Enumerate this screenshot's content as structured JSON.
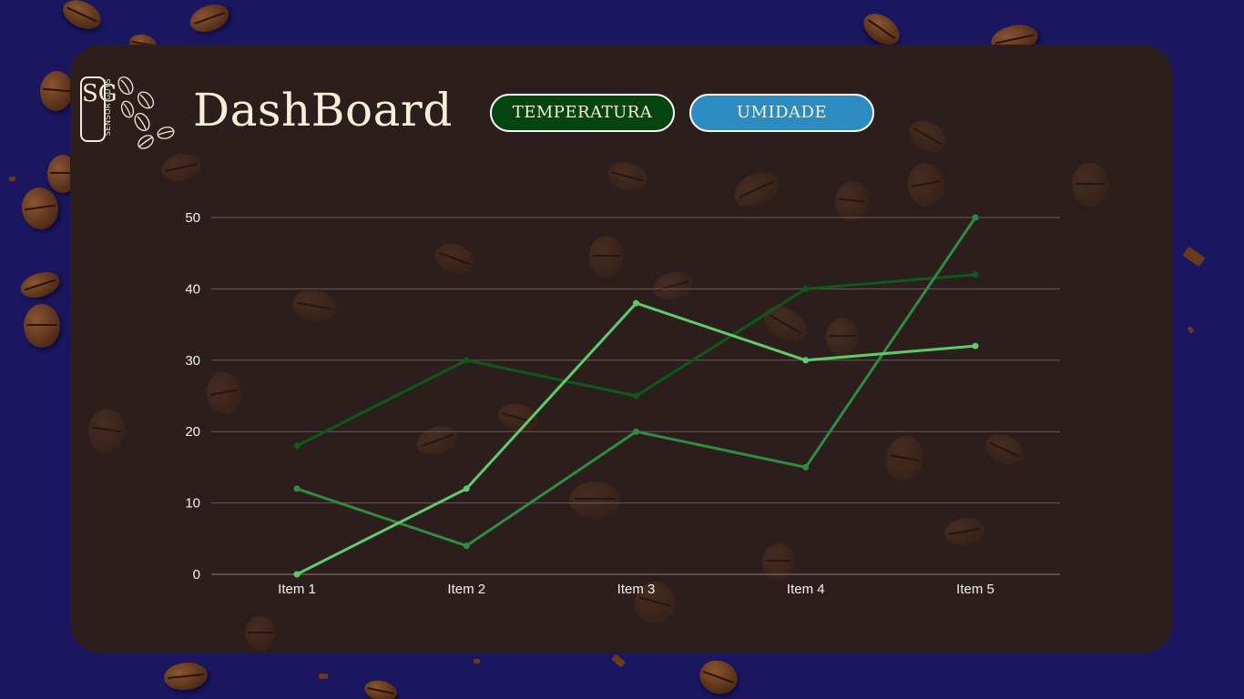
{
  "header": {
    "title": "DashBoard",
    "logo_text": "SG",
    "logo_subtext": "SENSOR GUYS"
  },
  "buttons": {
    "temperatura": "TEMPERATURA",
    "umidade": "UMIDADE"
  },
  "colors": {
    "background": "#1a1660",
    "panel": "#2d1e1e",
    "temperatura_button": "#054510",
    "umidade_button": "#2c8cc2",
    "series_dark": "#0b5b18",
    "series_mid": "#2f8c41",
    "series_light": "#5fcc6b",
    "gridline": "#6a5a5a"
  },
  "chart_data": {
    "type": "line",
    "categories": [
      "Item 1",
      "Item 2",
      "Item 3",
      "Item 4",
      "Item 5"
    ],
    "series": [
      {
        "color": "#0b5b18",
        "values": [
          18,
          30,
          25,
          40,
          42
        ]
      },
      {
        "color": "#2f8c41",
        "values": [
          12,
          4,
          20,
          15,
          50
        ]
      },
      {
        "color": "#5fcc6b",
        "values": [
          0,
          12,
          38,
          30,
          32
        ]
      }
    ],
    "yticks": [
      0,
      10,
      20,
      30,
      40,
      50
    ],
    "ylim": [
      0,
      50
    ],
    "grid": true,
    "legend": "none"
  }
}
